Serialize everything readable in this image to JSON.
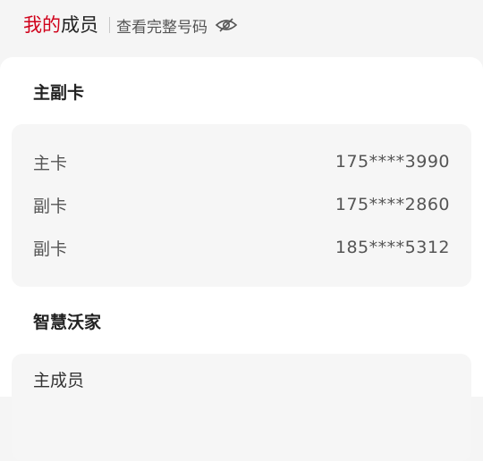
{
  "header": {
    "title_accent": "我的",
    "title_rest": "成员",
    "show_full_numbers": "查看完整号码",
    "accent_color": "#d0021b",
    "eye_icon": "eye-slash-icon"
  },
  "main_sub_cards": {
    "title": "主副卡",
    "rows": [
      {
        "label": "主卡",
        "number": "175****3990"
      },
      {
        "label": "副卡",
        "number": "175****2860"
      },
      {
        "label": "副卡",
        "number": "185****5312"
      }
    ]
  },
  "smart_home": {
    "title": "智慧沃家",
    "first_label": "主成员"
  }
}
